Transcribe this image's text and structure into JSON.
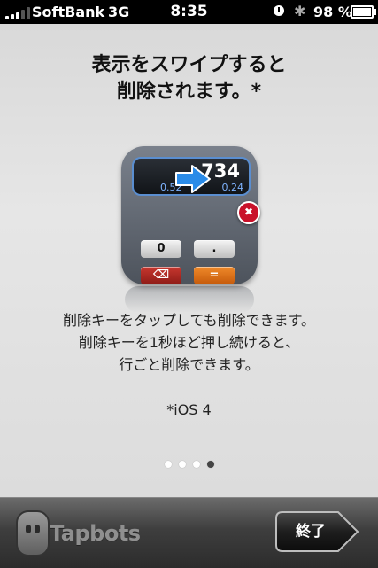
{
  "status_bar": {
    "carrier": "SoftBank",
    "network": "3G",
    "time": "8:35",
    "battery_percent": "98 %",
    "icons": [
      "signal-icon",
      "alarm-icon",
      "bluetooth-icon",
      "battery-icon"
    ]
  },
  "tutorial": {
    "title_line1": "表示をスワイプすると",
    "title_line2": "削除されます。*",
    "illustration": {
      "display_value": "734",
      "display_small_left": "0.52",
      "display_small_right": "0.24",
      "key_zero": "0",
      "key_dot": ".",
      "key_delete_icon": "backspace-icon",
      "key_equals": "=",
      "arrow_icon": "right-arrow-icon",
      "delete_badge_icon": "close-icon"
    },
    "description_line1": "削除キーをタップしても削除できます。",
    "description_line2": "削除キーを1秒ほど押し続けると、",
    "description_line3": "行ごと削除できます。",
    "note": "*iOS 4",
    "page_indicator": {
      "total": 4,
      "current": 4
    }
  },
  "bottom_bar": {
    "logo_text": "Tapbots",
    "finish_button": "終了"
  },
  "colors": {
    "panel_bg": "#dcdcdc",
    "bottom_bar_bg": "#3e3e3e",
    "delete_red": "#c9112a",
    "arrow_blue": "#2a8be8"
  }
}
